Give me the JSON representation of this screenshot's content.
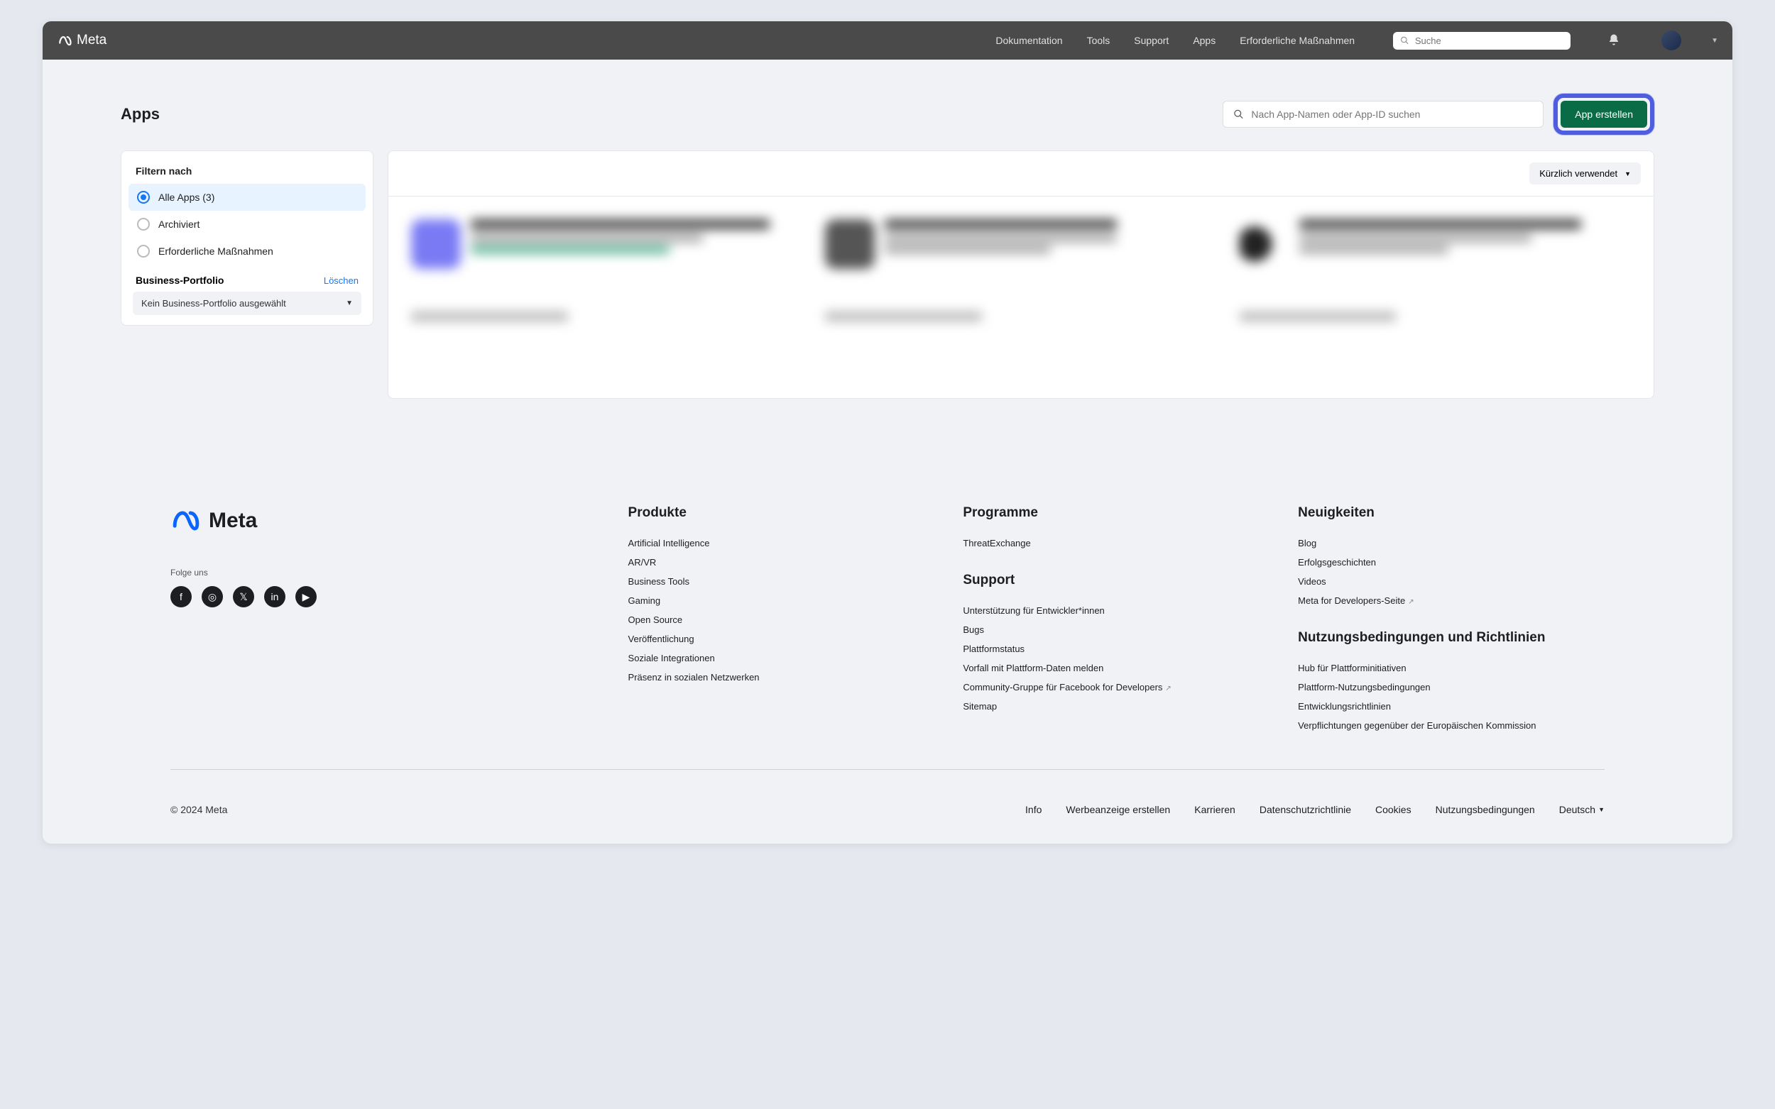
{
  "topbar": {
    "brand": "Meta",
    "nav": [
      "Dokumentation",
      "Tools",
      "Support",
      "Apps",
      "Erforderliche Maßnahmen"
    ],
    "search_placeholder": "Suche"
  },
  "page": {
    "title": "Apps",
    "search_placeholder": "Nach App-Namen oder App-ID suchen",
    "create_button": "App erstellen",
    "sort_label": "Kürzlich verwendet"
  },
  "filter": {
    "heading": "Filtern nach",
    "options": [
      {
        "label": "Alle Apps (3)",
        "selected": true
      },
      {
        "label": "Archiviert",
        "selected": false
      },
      {
        "label": "Erforderliche Maßnahmen",
        "selected": false
      }
    ],
    "portfolio_label": "Business-Portfolio",
    "clear": "Löschen",
    "portfolio_placeholder": "Kein Business-Portfolio ausgewählt"
  },
  "footer": {
    "brand": "Meta",
    "follow": "Folge uns",
    "columns": {
      "products": {
        "title": "Produkte",
        "links": [
          "Artificial Intelligence",
          "AR/VR",
          "Business Tools",
          "Gaming",
          "Open Source",
          "Veröffentlichung",
          "Soziale Integrationen",
          "Präsenz in sozialen Netzwerken"
        ]
      },
      "programs": {
        "title": "Programme",
        "links": [
          "ThreatExchange"
        ]
      },
      "support": {
        "title": "Support",
        "links": [
          "Unterstützung für Entwickler*innen",
          "Bugs",
          "Plattformstatus",
          "Vorfall mit Plattform-Daten melden",
          "Community-Gruppe für Facebook for Developers",
          "Sitemap"
        ]
      },
      "news": {
        "title": "Neuigkeiten",
        "links": [
          "Blog",
          "Erfolgsgeschichten",
          "Videos",
          "Meta for Developers-Seite"
        ]
      },
      "terms": {
        "title": "Nutzungsbedingungen und Richtlinien",
        "links": [
          "Hub für Plattforminitiativen",
          "Plattform-Nutzungsbedingungen",
          "Entwicklungsrichtlinien",
          "Verpflichtungen gegenüber der Europäischen Kommission"
        ]
      }
    },
    "copyright": "© 2024 Meta",
    "bottom_links": [
      "Info",
      "Werbeanzeige erstellen",
      "Karrieren",
      "Datenschutzrichtlinie",
      "Cookies",
      "Nutzungsbedingungen"
    ],
    "language": "Deutsch"
  }
}
